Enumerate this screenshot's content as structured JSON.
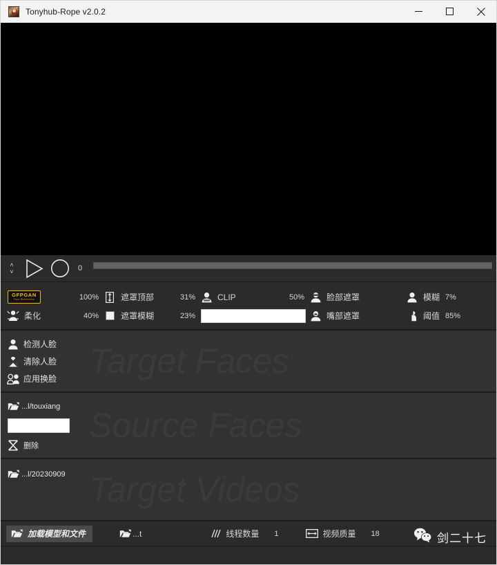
{
  "titlebar": {
    "title": "Tonyhub-Rope v2.0.2",
    "app_icon": "app-portrait-icon",
    "minimize": "minimize-icon",
    "maximize": "maximize-icon",
    "close": "close-icon"
  },
  "playback": {
    "chevron_up": "˄",
    "chevron_down": "˅",
    "play_icon": "play-icon",
    "record_icon": "record-icon",
    "frame_number": "0"
  },
  "settings": {
    "row1": [
      {
        "icon": "gfpgan-badge",
        "badge_title": "GFPGAN",
        "badge_sub": "Face Restoration",
        "label": "",
        "value": "100%"
      },
      {
        "icon": "mask-top-icon",
        "label": "遮罩顶部",
        "value": "31%"
      },
      {
        "icon": "clip-person-icon",
        "label": "CLIP",
        "value": "50%"
      },
      {
        "icon": "face-mask-icon",
        "label": "脸部遮罩",
        "value": ""
      },
      {
        "icon": "blur-person-icon",
        "label": "模糊",
        "value": "7%"
      }
    ],
    "row2": [
      {
        "icon": "soften-icon",
        "label": "柔化",
        "value": "40%"
      },
      {
        "icon": "mask-blur-icon",
        "label": "遮罩模糊",
        "value": "23%"
      },
      {
        "icon": "clip-text-input",
        "label": "",
        "value": ""
      },
      {
        "icon": "mouth-mask-icon",
        "label": "嘴部遮罩",
        "value": ""
      },
      {
        "icon": "threshold-icon",
        "label": "阈值",
        "value": "85%"
      }
    ]
  },
  "target_faces": {
    "watermark": "Target Faces",
    "buttons": [
      {
        "icon": "detect-face-icon",
        "label": "检测人脸"
      },
      {
        "icon": "clear-face-icon",
        "label": "清除人脸"
      },
      {
        "icon": "apply-swap-icon",
        "label": "应用换脸"
      }
    ]
  },
  "source_faces": {
    "watermark": "Source Faces",
    "folder_icon": "folder-icon",
    "folder_path": "...l/touxiang",
    "search_value": "",
    "search_placeholder": "",
    "delete_icon": "delete-face-icon",
    "delete_label": "删除"
  },
  "target_videos": {
    "watermark": "Target Videos",
    "folder_icon": "folder-icon",
    "folder_path": "...l/20230909"
  },
  "bottombar": {
    "load_button": {
      "icon": "folder-open-icon",
      "label": "加载模型和文件"
    },
    "output_folder": {
      "icon": "folder-icon",
      "label": "...t"
    },
    "threads": {
      "icon": "threads-icon",
      "label": "线程数量",
      "value": "1"
    },
    "quality": {
      "icon": "video-quality-icon",
      "label": "视频质量",
      "value": "18"
    }
  },
  "watermark_overlay": {
    "icon": "wechat-icon",
    "text": "剑二十七"
  },
  "colors": {
    "window_bg": "#2b2b2b",
    "panel_bg": "#323232",
    "preview_bg": "#000000",
    "titlebar_bg": "#f3f3f3",
    "accent_yellow": "#e8b63a",
    "text_light": "#d6d6d6",
    "watermark_text": "#3b3b3b"
  }
}
